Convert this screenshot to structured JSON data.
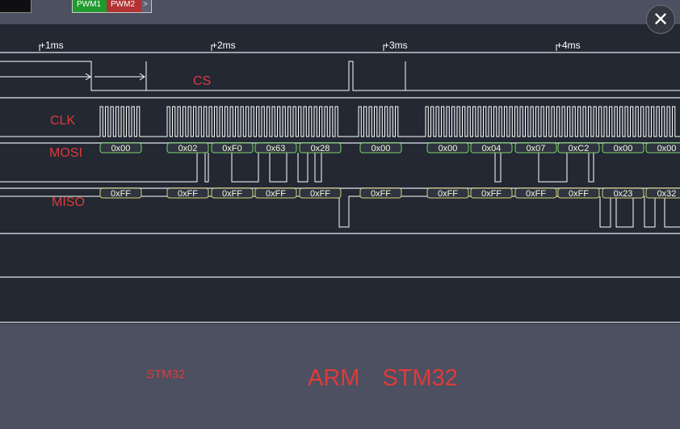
{
  "tabs": {
    "pwm1": "PWM1",
    "pwm2": "PWM2",
    "more": ">"
  },
  "close": {
    "icon": "✕"
  },
  "timeline": {
    "ticks": [
      "+1ms",
      "+2ms",
      "+3ms",
      "+4ms"
    ]
  },
  "channels": {
    "cs": "CS",
    "clk": "CLK",
    "mosi": "MOSI",
    "miso": "MISO"
  },
  "mosi_bytes": [
    "0x00",
    "0x02",
    "0xF0",
    "0x63",
    "0x28",
    "0x00",
    "0x00",
    "0x04",
    "0x07",
    "0xC2",
    "0x00",
    "0x00"
  ],
  "miso_bytes": [
    "0xFF",
    "0xFF",
    "0xFF",
    "0xFF",
    "0xFF",
    "0xFF",
    "0xFF",
    "0xFF",
    "0xFF",
    "0xFF",
    "0x23",
    "0x32"
  ],
  "footer": {
    "small": "STM32",
    "big_left": "ARM",
    "big_right": "STM32"
  },
  "colors": {
    "accent": "#e03a3a",
    "byte_fill": "#f7f9e0",
    "byte_border": "#7fd36a"
  }
}
